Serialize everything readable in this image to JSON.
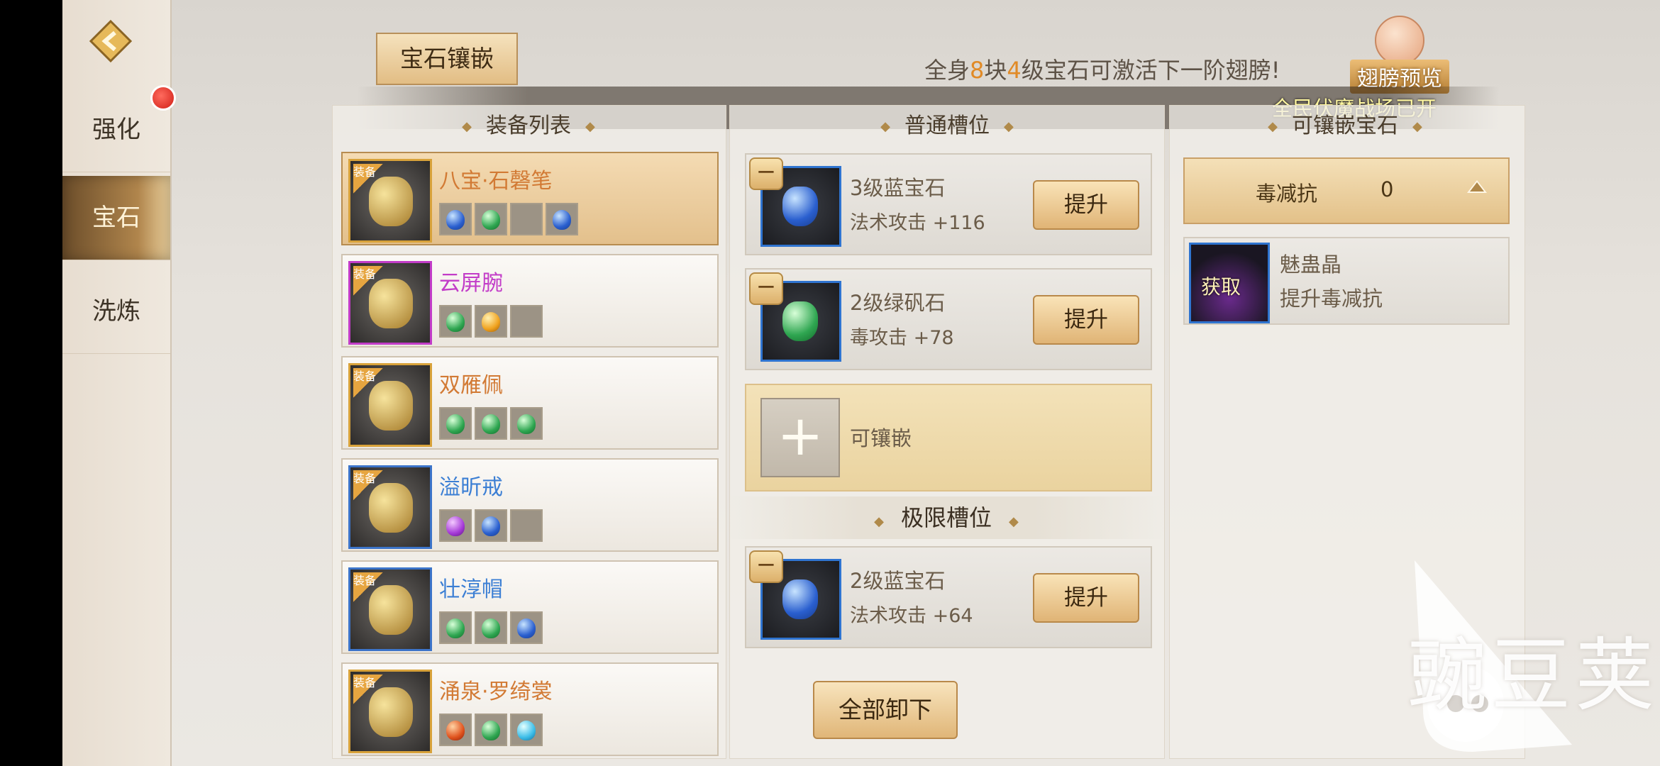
{
  "nav": {
    "tabs": [
      {
        "label": "强化",
        "badge": true
      },
      {
        "label": "宝石",
        "active": true
      },
      {
        "label": "洗炼"
      }
    ]
  },
  "header": {
    "tab_label": "宝石镶嵌",
    "banner": {
      "pre": "全身",
      "n1": "8",
      "mid": "块",
      "n2": "4",
      "post": "级宝石可激活下一阶翅膀!"
    },
    "wing_preview": "翅膀预览",
    "marquee": "全民伏魔战场已开"
  },
  "columns": {
    "equip_list": "装备列表",
    "normal_slots": "普通槽位",
    "available_gems": "可镶嵌宝石"
  },
  "equipment": [
    {
      "name": "八宝·石磬笔",
      "tag": "装备",
      "color": "#d27a34",
      "frame": "gold",
      "gems": [
        "blue",
        "green",
        "",
        "blue"
      ]
    },
    {
      "name": "云屏腕",
      "tag": "装备",
      "color": "#c23cc8",
      "frame": "purple",
      "gems": [
        "green",
        "orange",
        ""
      ]
    },
    {
      "name": "双雁佩",
      "tag": "装备",
      "color": "#d27a34",
      "frame": "gold",
      "gems": [
        "green",
        "green",
        "green"
      ]
    },
    {
      "name": "溢昕戒",
      "tag": "装备",
      "color": "#3c7fd4",
      "frame": "blue",
      "gems": [
        "purple",
        "blue",
        ""
      ]
    },
    {
      "name": "壮淳帽",
      "tag": "装备",
      "color": "#3c7fd4",
      "frame": "blue",
      "gems": [
        "green",
        "green",
        "blue"
      ]
    },
    {
      "name": "涌泉·罗绮裳",
      "tag": "装备",
      "color": "#d27a34",
      "frame": "gold",
      "gems": [
        "red",
        "green",
        "cyan"
      ]
    }
  ],
  "normal_slots": [
    {
      "gem": "3级蓝宝石",
      "stat": "法术攻击 +116",
      "color": "blue",
      "button": "提升"
    },
    {
      "gem": "2级绿矾石",
      "stat": "毒攻击 +78",
      "color": "green",
      "button": "提升"
    }
  ],
  "add_slot_label": "可镶嵌",
  "limit_title": "极限槽位",
  "limit_slots": [
    {
      "gem": "2级蓝宝石",
      "stat": "法术攻击 +64",
      "color": "blue",
      "button": "提升"
    }
  ],
  "unload_all": "全部卸下",
  "resist": {
    "name": "毒减抗",
    "value": "0"
  },
  "source_item": {
    "action": "获取",
    "name": "魅蛊晶",
    "desc": "提升毒减抗"
  },
  "watermark": "豌豆荚"
}
